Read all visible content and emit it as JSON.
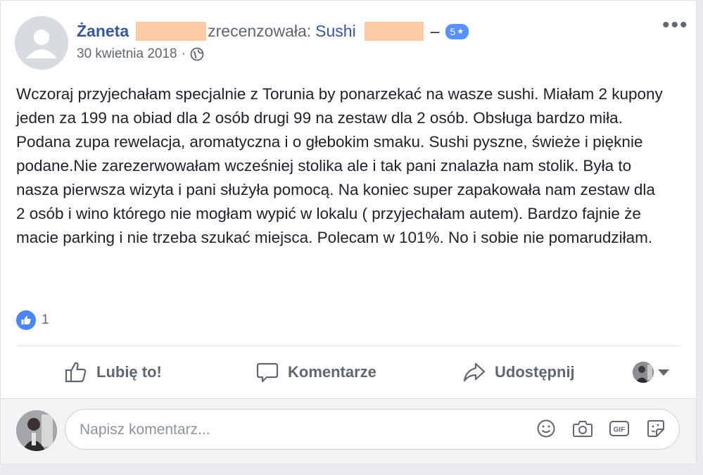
{
  "post": {
    "author": "Żaneta",
    "action": "zrecenzowała:",
    "page": "Sushi",
    "dash": "–",
    "rating": "5",
    "rating_star": "★",
    "date": "30 kwietnia 2018",
    "separator": "·",
    "privacy_icon": "globe-icon",
    "body": "Wczoraj przyjechałam specjalnie z Torunia by ponarzekać na wasze sushi. Miałam 2 kupony jeden za 199 na obiad dla 2 osób drugi 99 na zestaw dla 2 osób. Obsługa bardzo miła. Podana zupa rewelacja, aromatyczna i o głebokim smaku. Sushi pyszne, świeże i pięknie podane.Nie zarezerwowałam wcześniej stolika ale i tak pani znalazła nam stolik. Była to nasza pierwsza wizyta i pani służyła pomocą. Na koniec super zapakowała nam zestaw dla 2 osób i wino którego nie mogłam wypić w lokalu ( przyjechałam autem). Bardzo fajnie że macie parking i nie trzeba szukać miejsca. Polecam w 101%. No i sobie nie pomarudziłam.",
    "more_icon": "•••",
    "redaction_color": "#fbcba6"
  },
  "reactions": {
    "count": "1",
    "type_icon": "like-icon"
  },
  "actions": {
    "like": "Lubię to!",
    "comment": "Komentarze",
    "share": "Udostępnij"
  },
  "comment": {
    "placeholder": "Napisz komentarz...",
    "tools": [
      "emoji-icon",
      "camera-icon",
      "gif-icon",
      "sticker-icon"
    ]
  },
  "colors": {
    "link": "#385898",
    "muted": "#606770",
    "like_blue": "#4a86f7",
    "badge": "#5890ff"
  }
}
